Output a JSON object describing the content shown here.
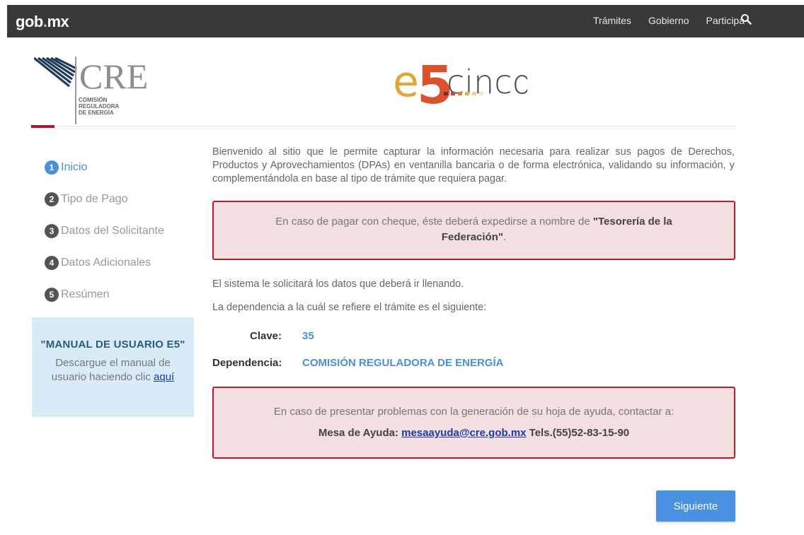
{
  "topbar": {
    "brand": "gob",
    "brand_sep": ".",
    "brand_tld": "mx",
    "nav": [
      "Trámites",
      "Gobierno",
      "Participa"
    ],
    "colors": {
      "bar": "#393939",
      "text": "#ffffff"
    }
  },
  "header": {
    "cre_logo": {
      "short": "CRE",
      "line1": "COMISIÓN",
      "line2": "REGULADORA",
      "line3": "DE ENERGÍA"
    },
    "e5_logo": {
      "prefix": "e",
      "number": "5",
      "suffix": "cinco"
    }
  },
  "steps": [
    {
      "num": "1",
      "label": "Inicio",
      "active": true
    },
    {
      "num": "2",
      "label": "Tipo de Pago",
      "active": false
    },
    {
      "num": "3",
      "label": "Datos del Solicitante",
      "active": false
    },
    {
      "num": "4",
      "label": "Datos Adicionales",
      "active": false
    },
    {
      "num": "5",
      "label": "Resúmen",
      "active": false
    }
  ],
  "manual": {
    "title": "\"MANUAL DE USUARIO E5\"",
    "text": "Descargue el manual de usuario haciendo clic ",
    "link": "aquí"
  },
  "main": {
    "intro": "Bienvenido al sitio que le permite capturar la información necesaria para realizar sus pagos de Derechos, Productos y Aprovechamientos (DPAs) en ventanilla bancaria o de forma electrónica, validando su información, y complementándola en base al tipo de trámite que requiera pagar.",
    "alert1_text": "En caso de pagar con cheque, éste deberá expedirse a nombre de ",
    "alert1_bold": "\"Tesorería de la Federación\"",
    "alert1_end": ".",
    "p1": "El sistema le solicitará los datos que deberá ir llenando.",
    "p2": "La dependencia a la cuál se refiere el trámite es el siguiente:",
    "clave_label": "Clave:",
    "clave_value": "35",
    "dependencia_label": "Dependencia:",
    "dependencia_value": "COMISIÓN REGULADORA DE ENERGÍA",
    "alert2_text": "En caso de presentar problemas con la generación de su hoja de ayuda, contactar a:",
    "help_label": "Mesa de Ayuda: ",
    "help_email": "mesaayuda@cre.gob.mx",
    "help_phone": " Tels.(55)52-83-15-90"
  },
  "next_button": "Siguiente",
  "colors": {
    "accent": "#4a90e2",
    "alert_border": "#c0182f",
    "alert_bg": "#f3dee0",
    "manual_bg": "#d9ebf7"
  }
}
